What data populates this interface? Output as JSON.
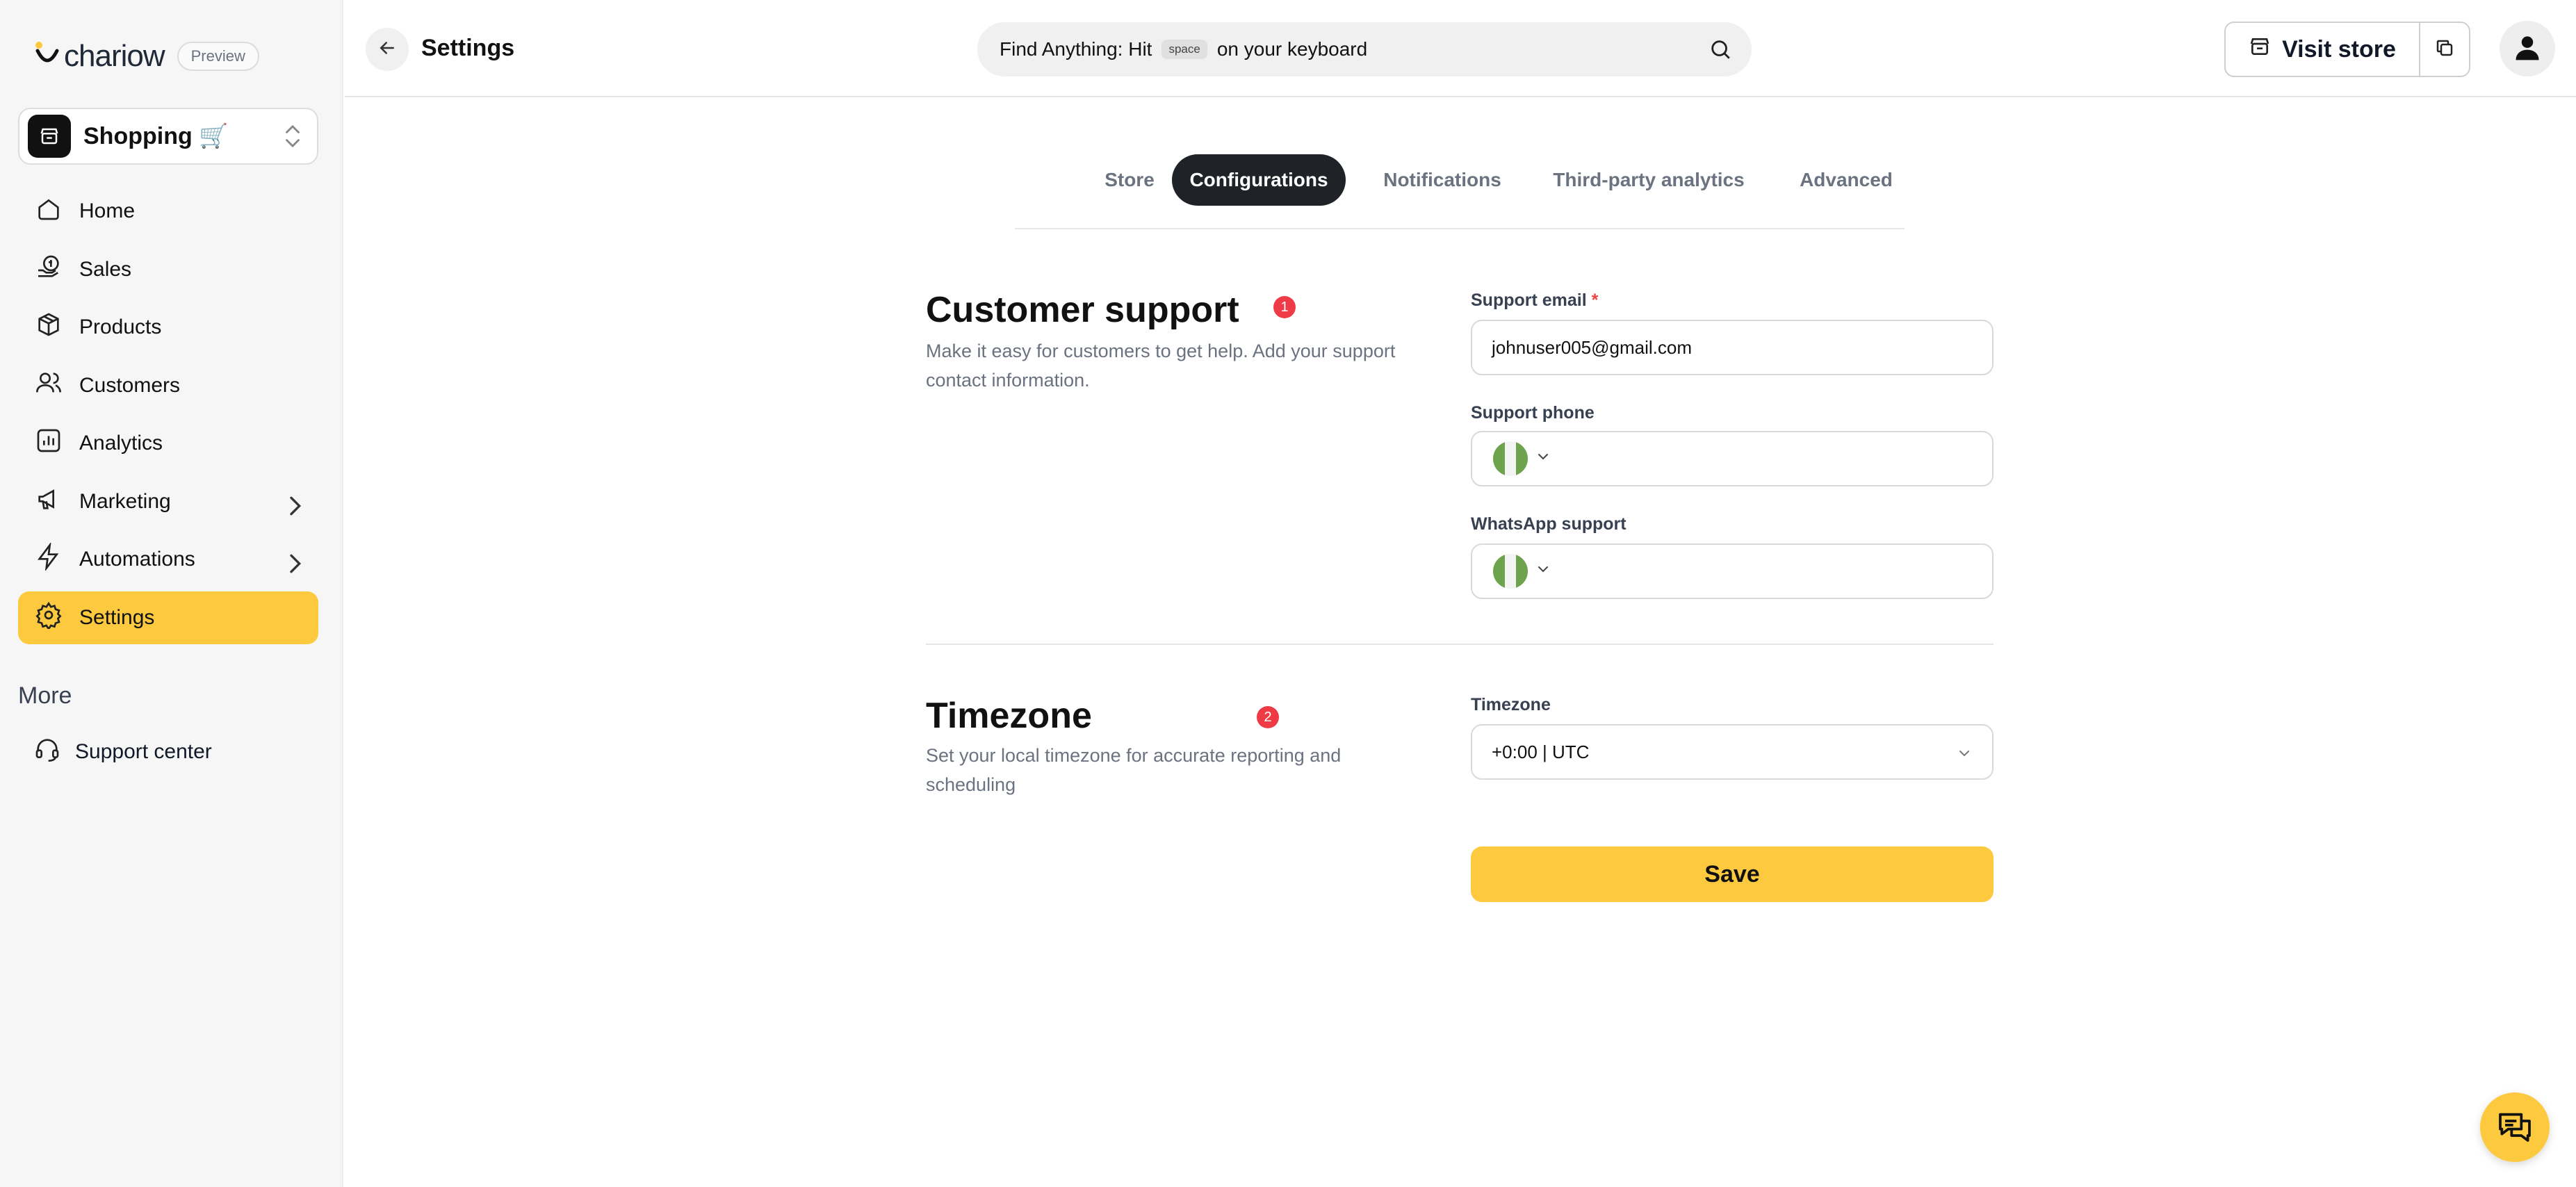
{
  "brand": {
    "name": "chariow",
    "badge": "Preview",
    "accent": "#fdc93e"
  },
  "store_switcher": {
    "name": "Shopping 🛒"
  },
  "sidebar": {
    "items": [
      {
        "label": "Home",
        "icon": "home-icon"
      },
      {
        "label": "Sales",
        "icon": "money-bag-icon"
      },
      {
        "label": "Products",
        "icon": "box-icon"
      },
      {
        "label": "Customers",
        "icon": "users-icon"
      },
      {
        "label": "Analytics",
        "icon": "chart-icon"
      },
      {
        "label": "Marketing",
        "icon": "megaphone-icon"
      },
      {
        "label": "Automations",
        "icon": "lightning-icon"
      },
      {
        "label": "Settings",
        "icon": "gear-icon",
        "active": true
      }
    ],
    "more_label": "More",
    "support_label": "Support center"
  },
  "header": {
    "title": "Settings",
    "search_prefix": "Find Anything: Hit",
    "search_key": "space",
    "search_suffix": "on your keyboard",
    "visit_store_label": "Visit store"
  },
  "tabs": [
    {
      "label": "Store"
    },
    {
      "label": "Configurations",
      "active": true
    },
    {
      "label": "Notifications"
    },
    {
      "label": "Third-party analytics"
    },
    {
      "label": "Advanced"
    }
  ],
  "customer_support": {
    "title": "Customer support",
    "badge": "1",
    "description": "Make it easy for customers to get help. Add your support contact information.",
    "email_label": "Support email",
    "email_required": "*",
    "email_value": "johnuser005@gmail.com",
    "phone_label": "Support phone",
    "whatsapp_label": "WhatsApp support"
  },
  "timezone": {
    "title": "Timezone",
    "badge": "2",
    "description": "Set your local timezone for accurate reporting and scheduling",
    "field_label": "Timezone",
    "value": "+0:00 | UTC"
  },
  "save_label": "Save"
}
